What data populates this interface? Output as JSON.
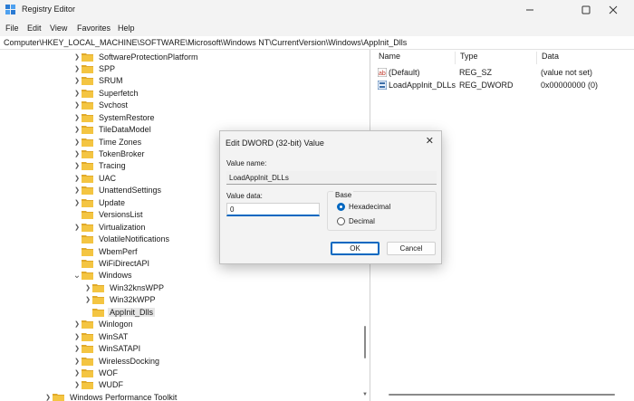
{
  "window": {
    "title": "Registry Editor"
  },
  "menu": [
    "File",
    "Edit",
    "View",
    "Favorites",
    "Help"
  ],
  "address": "Computer\\HKEY_LOCAL_MACHINE\\SOFTWARE\\Microsoft\\Windows NT\\CurrentVersion\\Windows\\AppInit_Dlls",
  "tree": [
    {
      "label": "SoftwareProtectionPlatform",
      "chevron": ">"
    },
    {
      "label": "SPP",
      "chevron": ">"
    },
    {
      "label": "SRUM",
      "chevron": ">"
    },
    {
      "label": "Superfetch",
      "chevron": ">"
    },
    {
      "label": "Svchost",
      "chevron": ">"
    },
    {
      "label": "SystemRestore",
      "chevron": ">"
    },
    {
      "label": "TileDataModel",
      "chevron": ">"
    },
    {
      "label": "Time Zones",
      "chevron": ">"
    },
    {
      "label": "TokenBroker",
      "chevron": ">"
    },
    {
      "label": "Tracing",
      "chevron": ">"
    },
    {
      "label": "UAC",
      "chevron": ">"
    },
    {
      "label": "UnattendSettings",
      "chevron": ">"
    },
    {
      "label": "Update",
      "chevron": ">"
    },
    {
      "label": "VersionsList",
      "chevron": ""
    },
    {
      "label": "Virtualization",
      "chevron": ">"
    },
    {
      "label": "VolatileNotifications",
      "chevron": ""
    },
    {
      "label": "WbemPerf",
      "chevron": ""
    },
    {
      "label": "WiFiDirectAPI",
      "chevron": ""
    },
    {
      "label": "Windows",
      "chevron": "v"
    },
    {
      "label": "Win32knsWPP",
      "chevron": ">"
    },
    {
      "label": "Win32kWPP",
      "chevron": ">"
    },
    {
      "label": "AppInit_Dlls",
      "chevron": ""
    },
    {
      "label": "Winlogon",
      "chevron": ">"
    },
    {
      "label": "WinSAT",
      "chevron": ">"
    },
    {
      "label": "WinSATAPI",
      "chevron": ">"
    },
    {
      "label": "WirelessDocking",
      "chevron": ">"
    },
    {
      "label": "WOF",
      "chevron": ">"
    },
    {
      "label": "WUDF",
      "chevron": ">"
    },
    {
      "label": "Windows Performance Toolkit",
      "chevron": ">"
    }
  ],
  "list": {
    "headers": {
      "name": "Name",
      "type": "Type",
      "data": "Data"
    },
    "rows": [
      {
        "name": "(Default)",
        "type": "REG_SZ",
        "data": "(value not set)",
        "icon": "string-value-icon"
      },
      {
        "name": "LoadAppInit_DLLs",
        "type": "REG_DWORD",
        "data": "0x00000000 (0)",
        "icon": "dword-value-icon"
      }
    ]
  },
  "dialog": {
    "title": "Edit DWORD (32-bit) Value",
    "value_name_label": "Value name:",
    "value_name": "LoadAppInit_DLLs",
    "value_data_label": "Value data:",
    "value_data": "0",
    "base_label": "Base",
    "hex_label": "Hexadecimal",
    "dec_label": "Decimal",
    "base_selected": "Hexadecimal",
    "ok_label": "OK",
    "cancel_label": "Cancel"
  },
  "colors": {
    "accent": "#0067c0",
    "folder": "#f4c542"
  }
}
